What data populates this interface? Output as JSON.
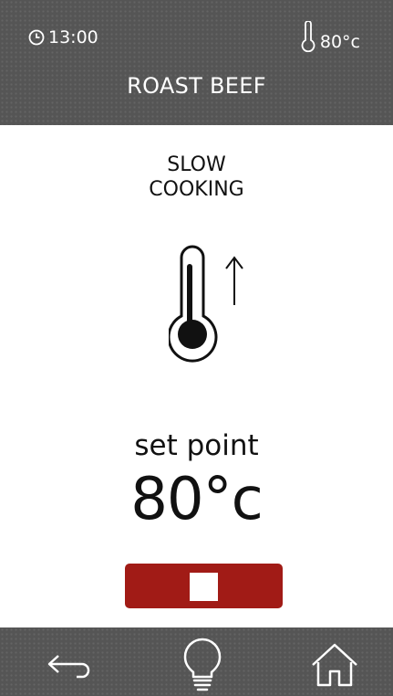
{
  "status": {
    "time": "13:00",
    "temperature": "80°c"
  },
  "recipe": {
    "title": "ROAST BEEF"
  },
  "mode": {
    "line1": "SLOW",
    "line2": "COOKING",
    "icon": "thermometer-rising-icon"
  },
  "setpoint": {
    "label": "set point",
    "value": "80°c"
  },
  "controls": {
    "stop_icon": "stop-icon",
    "stop_color": "#a11b16"
  },
  "footer": {
    "back_icon": "back-arrow-icon",
    "light_icon": "lightbulb-icon",
    "home_icon": "home-icon",
    "bar_color": "#555555"
  }
}
